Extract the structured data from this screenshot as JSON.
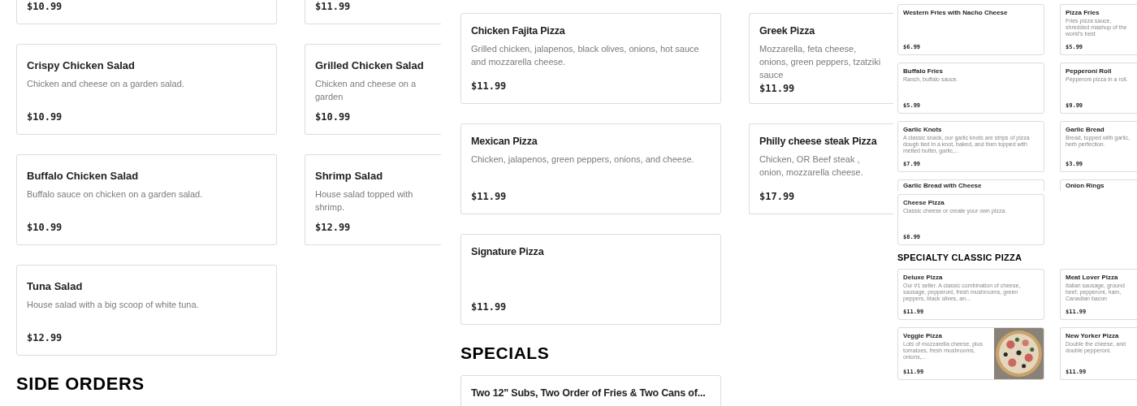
{
  "panels": [
    {
      "blocks": [
        {
          "kind": "cards",
          "cards": [
            {
              "price": "$10.99"
            },
            {
              "price": "$11.99"
            }
          ]
        },
        {
          "kind": "cards",
          "cards": [
            {
              "name": "Crispy Chicken Salad",
              "desc": "Chicken and cheese on a garden salad.",
              "price": "$10.99"
            },
            {
              "name": "Grilled Chicken Salad",
              "desc": "Chicken and cheese on a garden",
              "price": "$10.99"
            }
          ]
        },
        {
          "kind": "cards",
          "cards": [
            {
              "name": "Buffalo Chicken Salad",
              "desc": "Buffalo sauce on chicken on a garden salad.",
              "price": "$10.99"
            },
            {
              "name": "Shrimp Salad",
              "desc": "House salad topped with shrimp.",
              "price": "$12.99"
            }
          ]
        },
        {
          "kind": "cards",
          "cards": [
            {
              "name": "Tuna Salad",
              "desc": "House salad with a big scoop of white tuna.",
              "price": "$12.99"
            }
          ]
        },
        {
          "kind": "heading",
          "text": "SIDE ORDERS"
        }
      ]
    },
    {
      "blocks": [
        {
          "kind": "cards",
          "cards": [
            {
              "name": "Chicken Fajita Pizza",
              "desc": "Grilled chicken, jalapenos, black olives, onions, hot sauce and mozzarella cheese.",
              "price": "$11.99"
            },
            {
              "name": "Greek Pizza",
              "desc": "Mozzarella, feta cheese, onions, green peppers, tzatziki sauce",
              "price": "$11.99"
            }
          ]
        },
        {
          "kind": "cards",
          "cards": [
            {
              "name": "Mexican Pizza",
              "desc": "Chicken, jalapenos, green peppers, onions, and cheese.",
              "price": "$11.99"
            },
            {
              "name": "Philly cheese steak Pizza",
              "desc": "Chicken, OR Beef steak , onion, mozzarella cheese.",
              "price": "$17.99"
            }
          ]
        },
        {
          "kind": "cards",
          "cards": [
            {
              "name": "Signature Pizza",
              "price": "$11.99"
            }
          ]
        },
        {
          "kind": "heading",
          "text": "SPECIALS"
        },
        {
          "kind": "cards",
          "cards": [
            {
              "name": "Two 12\" Subs, Two Order of Fries & Two Cans of..."
            }
          ]
        }
      ]
    },
    {
      "blocks": [
        {
          "kind": "cards",
          "cards": [
            {
              "name": "Western Fries with Nacho Cheese",
              "price": "$6.99"
            },
            {
              "name": "Pizza Fries",
              "desc": "Fries pizza sauce, shredded mashup of the world's best",
              "price": "$5.99"
            }
          ]
        },
        {
          "kind": "cards",
          "cards": [
            {
              "name": "Buffalo Fries",
              "desc": "Ranch, buffalo sauce.",
              "price": "$5.99"
            },
            {
              "name": "Pepperoni Roll",
              "desc": "Pepperoni pizza in a roll.",
              "price": "$9.99"
            }
          ]
        },
        {
          "kind": "cards",
          "cards": [
            {
              "name": "Garlic Knots",
              "desc": "A classic snack, our garlic knots are strips of pizza dough tied in a knot, baked, and then topped with melted butter, garlic,...",
              "price": "$7.99"
            },
            {
              "name": "Garlic Bread",
              "desc": "Bread, topped with garlic, herb perfection.",
              "price": "$3.99"
            }
          ]
        },
        {
          "kind": "peek",
          "cards": [
            {
              "name": "Garlic Bread with Cheese"
            },
            {
              "name": "Onion Rings"
            }
          ]
        },
        {
          "kind": "cards",
          "cards": [
            {
              "name": "Cheese Pizza",
              "desc": "Classic cheese or create your own pizza.",
              "price": "$8.99"
            }
          ]
        },
        {
          "kind": "heading",
          "text": "SPECIALTY CLASSIC PIZZA"
        },
        {
          "kind": "cards",
          "cards": [
            {
              "name": "Deluxe Pizza",
              "desc": "Our #1 seller. A classic combination of cheese, sausage, pepperoni, fresh mushrooms, green peppers, black olives, an...",
              "price": "$11.99"
            },
            {
              "name": "Meat Lover Pizza",
              "desc": "Italian sausage, ground beef, pepperoni, ham, Canadian bacon",
              "price": "$11.99"
            }
          ]
        },
        {
          "kind": "cards",
          "cards": [
            {
              "name": "Veggie Pizza",
              "desc": "Lots of mozzarella cheese, plus tomatoes, fresh mushrooms, onions,...",
              "price": "$11.99",
              "picture": true
            },
            {
              "name": "New Yorker Pizza",
              "desc": "Double the cheese, and double pepperoni.",
              "price": "$11.99"
            }
          ]
        }
      ]
    }
  ]
}
